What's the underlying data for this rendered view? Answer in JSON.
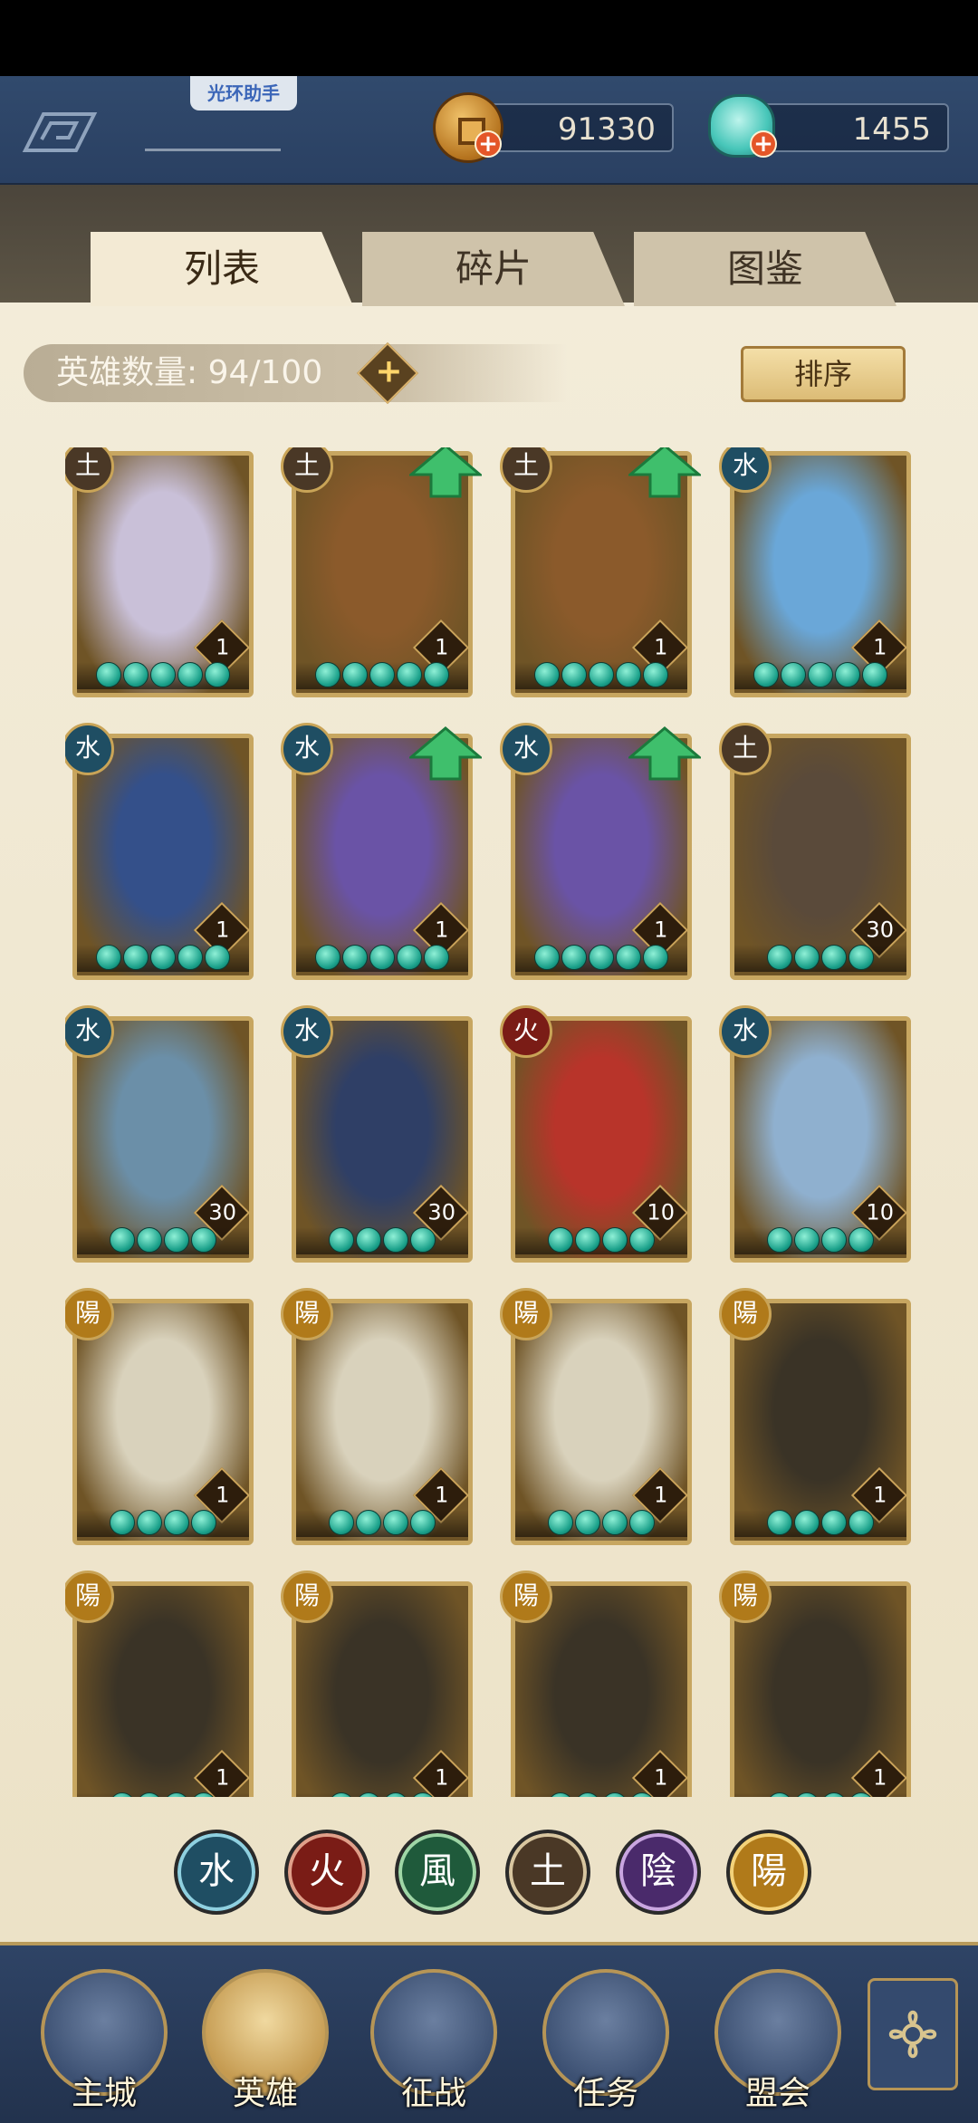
{
  "topbar": {
    "helper_tag": "光环助手",
    "coins": "91330",
    "jade": "1455"
  },
  "tabs": [
    {
      "label": "列表",
      "active": true
    },
    {
      "label": "碎片",
      "active": false
    },
    {
      "label": "图鉴",
      "active": false
    }
  ],
  "hero_count": {
    "label": "英雄数量: 94/100",
    "add": "+"
  },
  "sort_label": "排序",
  "colors": {
    "water": "#1f4e63",
    "fire": "#7a1c16",
    "wind": "#1f5a3b",
    "earth": "#4a3826",
    "yin": "#4a2a6b",
    "yang": "#b07a1a",
    "panel": "#f1e8d2",
    "gold": "#c7a660"
  },
  "heroes": [
    {
      "element": "earth",
      "glyph": "土",
      "level": "1",
      "stars": 5,
      "upgrade": false,
      "art": "#c9c0d8"
    },
    {
      "element": "earth",
      "glyph": "土",
      "level": "1",
      "stars": 5,
      "upgrade": true,
      "art": "#8b5a2b"
    },
    {
      "element": "earth",
      "glyph": "土",
      "level": "1",
      "stars": 5,
      "upgrade": true,
      "art": "#8b5a2b"
    },
    {
      "element": "water",
      "glyph": "水",
      "level": "1",
      "stars": 5,
      "upgrade": false,
      "art": "#6aa7d8"
    },
    {
      "element": "water",
      "glyph": "水",
      "level": "1",
      "stars": 5,
      "upgrade": false,
      "art": "#34508a"
    },
    {
      "element": "water",
      "glyph": "水",
      "level": "1",
      "stars": 5,
      "upgrade": true,
      "art": "#6a53a6"
    },
    {
      "element": "water",
      "glyph": "水",
      "level": "1",
      "stars": 5,
      "upgrade": true,
      "art": "#6a53a6"
    },
    {
      "element": "earth",
      "glyph": "土",
      "level": "30",
      "stars": 4,
      "upgrade": false,
      "art": "#5a4a3a"
    },
    {
      "element": "water",
      "glyph": "水",
      "level": "30",
      "stars": 4,
      "upgrade": false,
      "art": "#6b8fa8"
    },
    {
      "element": "water",
      "glyph": "水",
      "level": "30",
      "stars": 4,
      "upgrade": false,
      "art": "#2f3f66"
    },
    {
      "element": "fire",
      "glyph": "火",
      "level": "10",
      "stars": 4,
      "upgrade": false,
      "art": "#b8342a"
    },
    {
      "element": "water",
      "glyph": "水",
      "level": "10",
      "stars": 4,
      "upgrade": false,
      "art": "#8fb0cf"
    },
    {
      "element": "yang",
      "glyph": "陽",
      "level": "1",
      "stars": 4,
      "upgrade": false,
      "art": "#d9d2bc"
    },
    {
      "element": "yang",
      "glyph": "陽",
      "level": "1",
      "stars": 4,
      "upgrade": false,
      "art": "#d9d2bc"
    },
    {
      "element": "yang",
      "glyph": "陽",
      "level": "1",
      "stars": 4,
      "upgrade": false,
      "art": "#d9d2bc"
    },
    {
      "element": "yang",
      "glyph": "陽",
      "level": "1",
      "stars": 4,
      "upgrade": false,
      "art": "#3a3326"
    },
    {
      "element": "yang",
      "glyph": "陽",
      "level": "1",
      "stars": 4,
      "upgrade": false,
      "art": "#3a3326"
    },
    {
      "element": "yang",
      "glyph": "陽",
      "level": "1",
      "stars": 4,
      "upgrade": false,
      "art": "#3a3326"
    },
    {
      "element": "yang",
      "glyph": "陽",
      "level": "1",
      "stars": 4,
      "upgrade": false,
      "art": "#3a3326"
    },
    {
      "element": "yang",
      "glyph": "陽",
      "level": "1",
      "stars": 4,
      "upgrade": false,
      "art": "#3a3326"
    }
  ],
  "filters": [
    {
      "name": "water",
      "glyph": "水",
      "color": "#1f4e63",
      "ring": "#8fd0e0"
    },
    {
      "name": "fire",
      "glyph": "火",
      "color": "#7a1c16",
      "ring": "#e0a08a"
    },
    {
      "name": "wind",
      "glyph": "風",
      "color": "#1f5a3b",
      "ring": "#9fd6a6"
    },
    {
      "name": "earth",
      "glyph": "土",
      "color": "#4a3826",
      "ring": "#d8c6a0"
    },
    {
      "name": "yin",
      "glyph": "陰",
      "color": "#4a2a6b",
      "ring": "#c9a6e0"
    },
    {
      "name": "yang",
      "glyph": "陽",
      "color": "#b07a1a",
      "ring": "#f3d27a"
    }
  ],
  "nav": [
    {
      "label": "主城",
      "icon": "city-gate-icon",
      "active": false
    },
    {
      "label": "英雄",
      "icon": "hero-portrait-icon",
      "active": true
    },
    {
      "label": "征战",
      "icon": "battle-icon",
      "active": false
    },
    {
      "label": "任务",
      "icon": "quest-scroll-icon",
      "active": false
    },
    {
      "label": "盟会",
      "icon": "alliance-hall-icon",
      "active": false
    }
  ]
}
